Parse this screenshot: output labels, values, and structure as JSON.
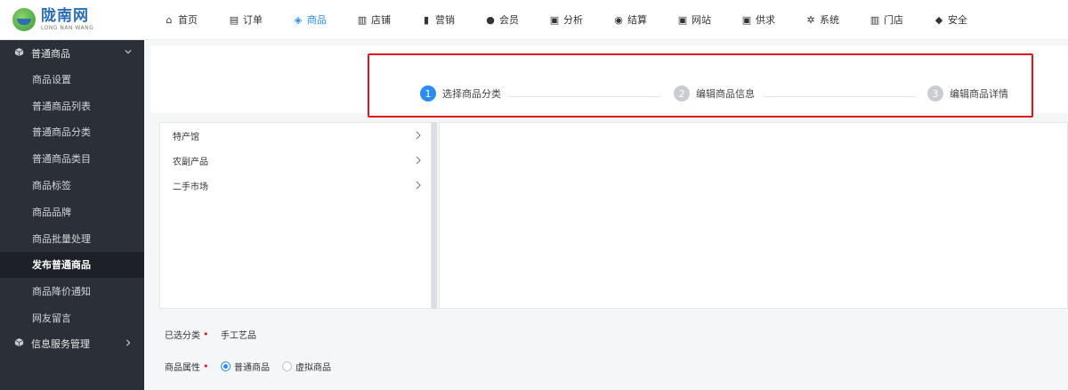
{
  "brand": {
    "name_cn": "陇南网",
    "name_en": "LONG NAN WANG"
  },
  "nav": [
    {
      "label": "首页",
      "icon": "home-icon",
      "glyph": "⌂",
      "active": false
    },
    {
      "label": "订单",
      "icon": "document-icon",
      "glyph": "▤",
      "active": false
    },
    {
      "label": "商品",
      "icon": "cube-icon",
      "glyph": "◈",
      "active": true
    },
    {
      "label": "店铺",
      "icon": "store-icon",
      "glyph": "▥",
      "active": false
    },
    {
      "label": "营销",
      "icon": "bar-chart-icon",
      "glyph": "▮",
      "active": false
    },
    {
      "label": "会员",
      "icon": "user-icon",
      "glyph": "●",
      "active": false
    },
    {
      "label": "分析",
      "icon": "monitor-chart-icon",
      "glyph": "▣",
      "active": false
    },
    {
      "label": "结算",
      "icon": "coin-icon",
      "glyph": "◉",
      "active": false
    },
    {
      "label": "网站",
      "icon": "screen-icon",
      "glyph": "▣",
      "active": false
    },
    {
      "label": "供求",
      "icon": "chat-icon",
      "glyph": "▣",
      "active": false
    },
    {
      "label": "系统",
      "icon": "gear-icon",
      "glyph": "✲",
      "active": false
    },
    {
      "label": "门店",
      "icon": "shop-icon",
      "glyph": "▥",
      "active": false
    },
    {
      "label": "安全",
      "icon": "shield-icon",
      "glyph": "◆",
      "active": false
    }
  ],
  "sidebar": {
    "group1": {
      "label": "普通商品",
      "icon": "cube-icon",
      "expanded": true
    },
    "items": [
      {
        "label": "商品设置",
        "active": false
      },
      {
        "label": "普通商品列表",
        "active": false
      },
      {
        "label": "普通商品分类",
        "active": false
      },
      {
        "label": "普通商品类目",
        "active": false
      },
      {
        "label": "商品标签",
        "active": false
      },
      {
        "label": "商品品牌",
        "active": false
      },
      {
        "label": "商品批量处理",
        "active": false
      },
      {
        "label": "发布普通商品",
        "active": true
      },
      {
        "label": "商品降价通知",
        "active": false
      },
      {
        "label": "网友留言",
        "active": false
      }
    ],
    "group2": {
      "label": "信息服务管理",
      "icon": "cube-icon",
      "expanded": false
    }
  },
  "steps": [
    {
      "num": "1",
      "label": "选择商品分类",
      "active": true
    },
    {
      "num": "2",
      "label": "编辑商品信息",
      "active": false
    },
    {
      "num": "3",
      "label": "编辑商品详情",
      "active": false
    }
  ],
  "categories": [
    "特产馆",
    "农副产品",
    "二手市场"
  ],
  "form": {
    "selected_label": "已选分类",
    "selected_value": "手工艺品",
    "attr_label": "商品属性",
    "options": [
      {
        "label": "普通商品",
        "checked": true
      },
      {
        "label": "虚拟商品",
        "checked": false
      }
    ]
  },
  "colors": {
    "accent": "#2d8cf0",
    "highlight_box": "#e0161d",
    "sidebar_bg": "#2b3038"
  }
}
